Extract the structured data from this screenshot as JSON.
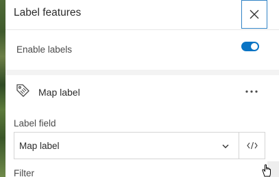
{
  "header": {
    "title": "Label features",
    "close_icon": "close-icon"
  },
  "enable_labels": {
    "label": "Enable labels",
    "enabled": true
  },
  "label_class": {
    "icon": "tag-icon",
    "title": "Map label",
    "more_icon": "more-options-icon"
  },
  "label_field": {
    "label": "Label field",
    "value": "Map label",
    "expression_icon": "code-icon"
  },
  "filter": {
    "label": "Filter"
  },
  "colors": {
    "accent": "#0a74c4",
    "focus_border": "#2f82c5",
    "separator": "#f3f3f3"
  }
}
